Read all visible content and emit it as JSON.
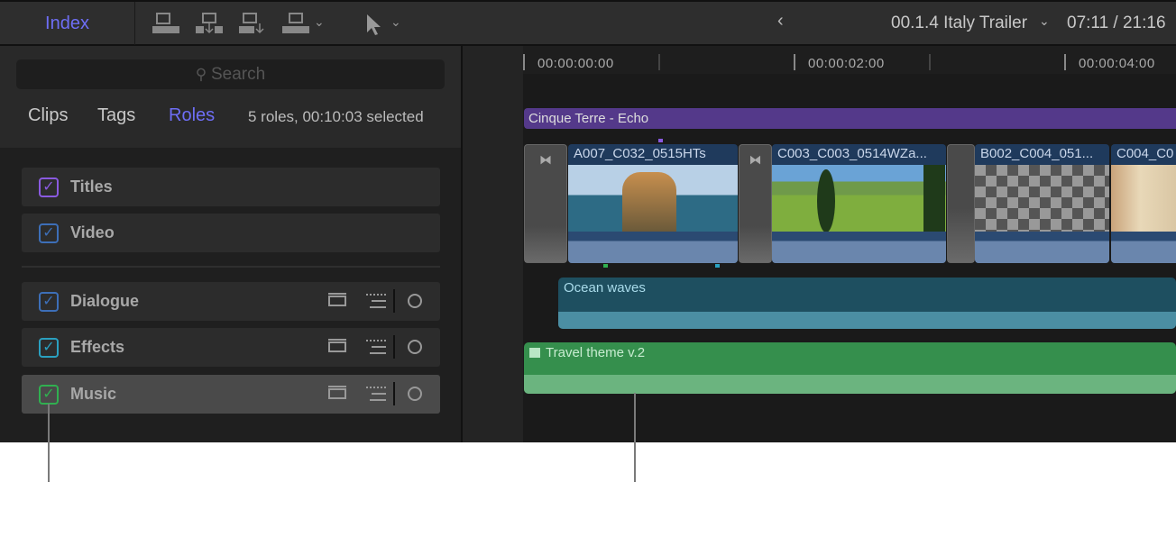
{
  "toolbar": {
    "index_label": "Index",
    "back_icon": "chevron-left",
    "project_name": "00.1.4 Italy Trailer",
    "timecode": "07:11 / 21:16"
  },
  "index": {
    "search_placeholder": "Search",
    "tabs": [
      "Clips",
      "Tags",
      "Roles"
    ],
    "active_tab": "Roles",
    "status": "5 roles, 00:10:03 selected",
    "roles": [
      {
        "label": "Titles",
        "checked": true,
        "color": "#8a5ae0"
      },
      {
        "label": "Video",
        "checked": true,
        "color": "#3d6fb8"
      },
      {
        "label": "Dialogue",
        "checked": true,
        "color": "#3d6fb8"
      },
      {
        "label": "Effects",
        "checked": true,
        "color": "#2aa0c0"
      },
      {
        "label": "Music",
        "checked": true,
        "color": "#30b050"
      }
    ]
  },
  "timeline": {
    "ruler": [
      "00:00:00:00",
      "00:00:02:00",
      "00:00:04:00"
    ],
    "title_clip": "Cinque Terre - Echo",
    "video_clips": [
      "A007_C032_0515HTs",
      "C003_C003_0514WZa...",
      "B002_C004_051...",
      "C004_C0"
    ],
    "audio_clips": [
      "Ocean waves",
      "Travel theme v.2"
    ]
  }
}
